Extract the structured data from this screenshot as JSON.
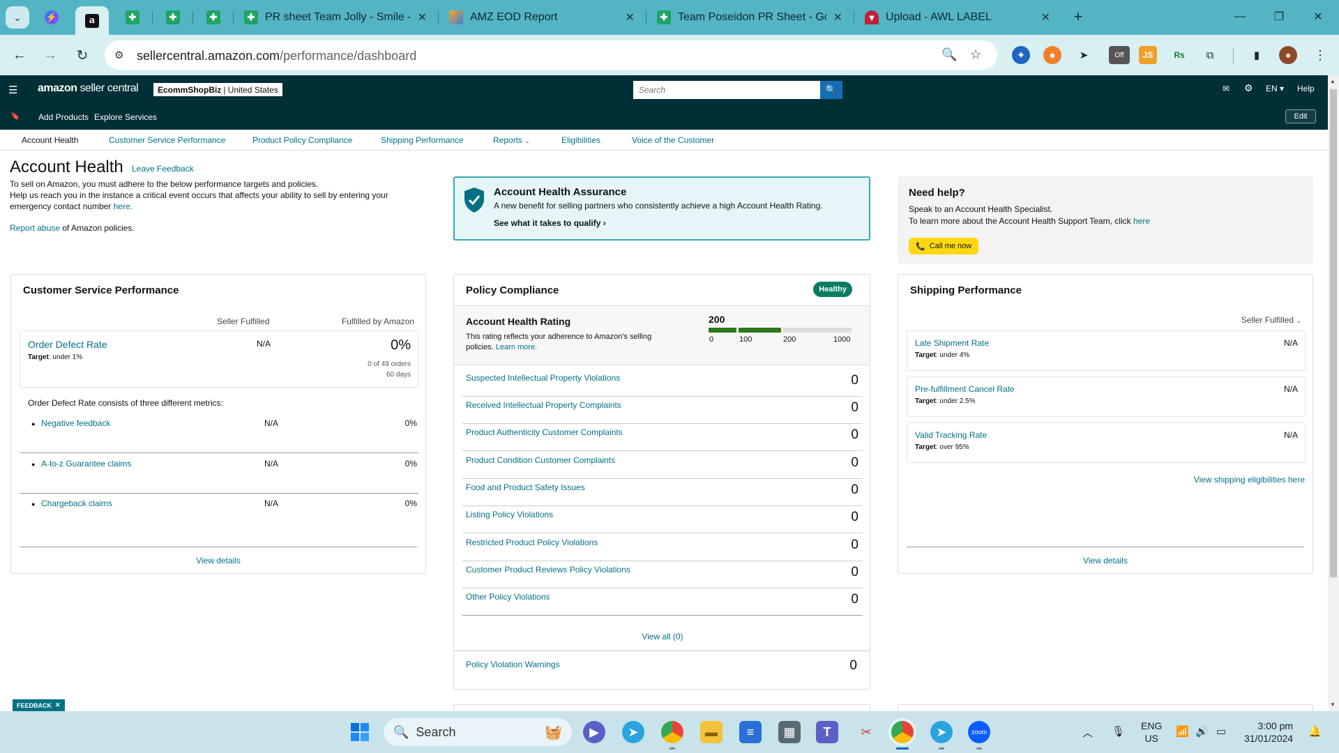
{
  "browser": {
    "tabs": [
      {
        "title": "PR sheet Team Jolly - Smile - Go",
        "favicon": "sheets-icon"
      },
      {
        "title": "AMZ EOD Report",
        "favicon": "amz-report-icon"
      },
      {
        "title": "Team Poseidon PR Sheet - Goo",
        "favicon": "sheets-icon"
      },
      {
        "title": "Upload - AWL LABEL",
        "favicon": "awl-icon"
      }
    ],
    "url_host": "sellercentral.amazon.com",
    "url_path": "/performance/dashboard",
    "extension_badge": "Off"
  },
  "header": {
    "logo_main": "amazon",
    "logo_sub": " seller central",
    "store_name": "EcommShopBiz",
    "store_region": "| United States",
    "search_placeholder": "Search",
    "language": "EN",
    "help": "Help"
  },
  "subheader": {
    "add_products": "Add Products",
    "explore_services": "Explore Services",
    "edit": "Edit"
  },
  "perf_nav": {
    "items": [
      "Account Health",
      "Customer Service Performance",
      "Product Policy Compliance",
      "Shipping Performance",
      "Reports",
      "Eligibilities",
      "Voice of the Customer"
    ]
  },
  "account_health": {
    "title": "Account Health",
    "leave_feedback": "Leave Feedback",
    "intro_line1": "To sell on Amazon, you must adhere to the below performance targets and policies.",
    "intro_line2": "Help us reach you in the instance a critical event occurs that affects your ability to sell by entering your emergency contact number",
    "intro_here": "here.",
    "report_abuse": "Report abuse",
    "report_rest": " of Amazon policies."
  },
  "assurance": {
    "title": "Account Health Assurance",
    "desc": "A new benefit for selling partners who consistently achieve a high Account Health Rating.",
    "qualify": "See what it takes to qualify"
  },
  "need_help": {
    "title": "Need help?",
    "line1": "Speak to an Account Health Specialist.",
    "line2": "To learn more about the Account Health Support Team, click",
    "here": "here",
    "call": "Call me now"
  },
  "customer_service": {
    "title": "Customer Service Performance",
    "col_seller": "Seller Fulfilled",
    "col_amazon": "Fulfilled by Amazon",
    "odr_name": "Order Defect Rate",
    "odr_target_label": "Target",
    "odr_target": ": under 1%",
    "odr_seller": "N/A",
    "odr_amazon": "0%",
    "odr_orders": "0 of 49 orders",
    "odr_days": "60 days",
    "consists": "Order Defect Rate consists of three different metrics:",
    "metrics": [
      {
        "name": "Negative feedback",
        "seller": "N/A",
        "amazon": "0%"
      },
      {
        "name": "A-to-z Guarantee claims",
        "seller": "N/A",
        "amazon": "0%"
      },
      {
        "name": "Chargeback claims",
        "seller": "N/A",
        "amazon": "0%"
      }
    ],
    "view_details": "View details"
  },
  "policy": {
    "title": "Policy Compliance",
    "status": "Healthy",
    "rating_title": "Account Health Rating",
    "rating_desc": "This rating reflects your adherence to Amazon's selling policies.",
    "learn_more": "Learn more.",
    "score": "200",
    "score_value": 200,
    "scale": [
      "0",
      "100",
      "200",
      "1000"
    ],
    "violations": [
      {
        "name": "Suspected Intellectual Property Violations",
        "value": "0"
      },
      {
        "name": "Received Intellectual Property Complaints",
        "value": "0"
      },
      {
        "name": "Product Authenticity Customer Complaints",
        "value": "0"
      },
      {
        "name": "Product Condition Customer Complaints",
        "value": "0"
      },
      {
        "name": "Food and Product Safety Issues",
        "value": "0"
      },
      {
        "name": "Listing Policy Violations",
        "value": "0"
      },
      {
        "name": "Restricted Product Policy Violations",
        "value": "0"
      },
      {
        "name": "Customer Product Reviews Policy Violations",
        "value": "0"
      },
      {
        "name": "Other Policy Violations",
        "value": "0"
      }
    ],
    "view_all": "View all (0)",
    "warnings_name": "Policy Violation Warnings",
    "warnings_value": "0"
  },
  "shipping": {
    "title": "Shipping Performance",
    "filter": "Seller Fulfilled",
    "metrics": [
      {
        "name": "Late Shipment Rate",
        "target_label": "Target",
        "target": ": under 4%",
        "value": "N/A"
      },
      {
        "name": "Pre-fulfillment Cancel Rate",
        "target_label": "Target",
        "target": ": under 2.5%",
        "value": "N/A"
      },
      {
        "name": "Valid Tracking Rate",
        "target_label": "Target",
        "target": ": over 95%",
        "value": "N/A"
      }
    ],
    "eligibilities": "View shipping eligibilities here",
    "view_details": "View details"
  },
  "feedback_tab": "FEEDBACK",
  "taskbar": {
    "search": "Search",
    "lang1": "ENG",
    "lang2": "US",
    "time": "3:00 pm",
    "date": "31/01/2024"
  },
  "colors": {
    "header_bg": "#002f36",
    "link": "#007185",
    "healthy": "#067d62",
    "tab_strip": "#53b4c4",
    "call_button": "#ffd814"
  }
}
